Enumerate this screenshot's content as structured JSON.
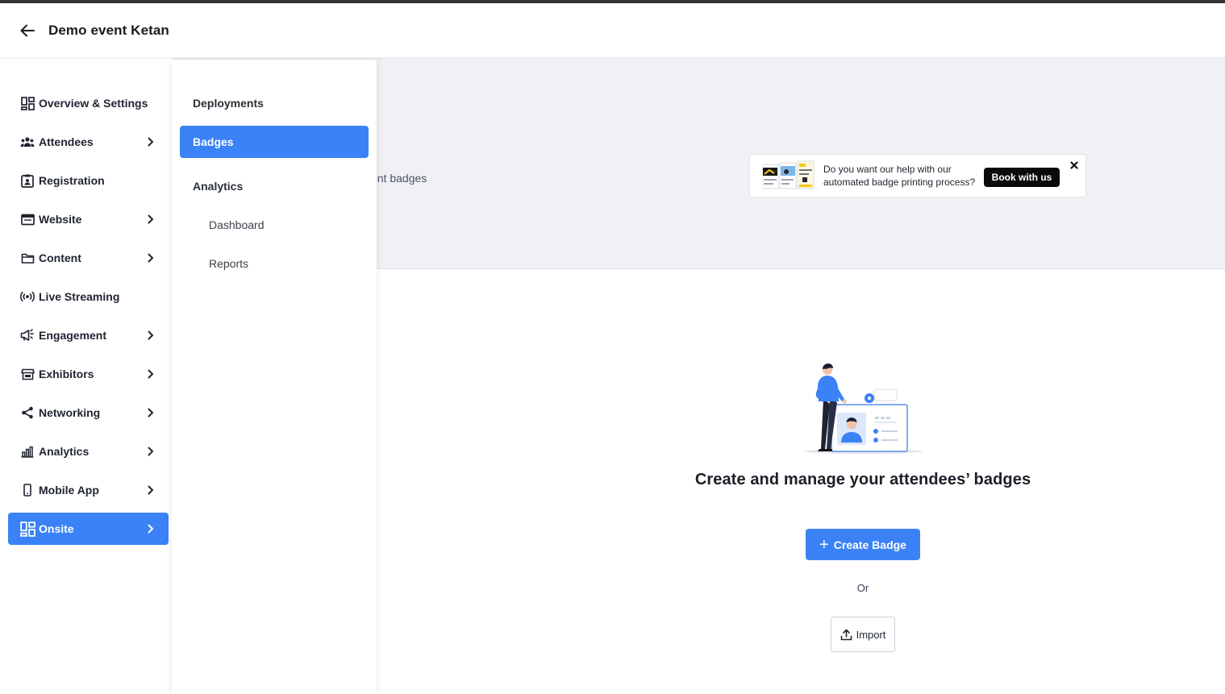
{
  "header": {
    "title": "Demo event Ketan"
  },
  "sidebar": {
    "items": [
      {
        "label": "Overview & Settings",
        "icon": "dashboard-grid-icon",
        "has_children": false
      },
      {
        "label": "Attendees",
        "icon": "people-icon",
        "has_children": true
      },
      {
        "label": "Registration",
        "icon": "id-card-icon",
        "has_children": false
      },
      {
        "label": "Website",
        "icon": "browser-window-icon",
        "has_children": true
      },
      {
        "label": "Content",
        "icon": "folder-icon",
        "has_children": true
      },
      {
        "label": "Live Streaming",
        "icon": "broadcast-icon",
        "has_children": false
      },
      {
        "label": "Engagement",
        "icon": "megaphone-icon",
        "has_children": true
      },
      {
        "label": "Exhibitors",
        "icon": "storefront-icon",
        "has_children": true
      },
      {
        "label": "Networking",
        "icon": "share-nodes-icon",
        "has_children": true
      },
      {
        "label": "Analytics",
        "icon": "bar-chart-icon",
        "has_children": true
      },
      {
        "label": "Mobile App",
        "icon": "mobile-phone-icon",
        "has_children": true
      },
      {
        "label": "Onsite",
        "icon": "dashboard-grid-icon",
        "has_children": true,
        "active": true
      }
    ]
  },
  "submenu": {
    "items": [
      {
        "label": "Deployments",
        "level": 1
      },
      {
        "label": "Badges",
        "level": 1,
        "active": true
      },
      {
        "label": "Analytics",
        "level": 1
      },
      {
        "label": "Dashboard",
        "level": 2
      },
      {
        "label": "Reports",
        "level": 2
      }
    ]
  },
  "background": {
    "partial_text": "ent badges"
  },
  "promo": {
    "text": "Do you want our help with our automated badge printing process?",
    "button_label": "Book with us"
  },
  "empty_state": {
    "title": "Create and manage your attendees’ badges",
    "create_label": "Create Badge",
    "or_label": "Or",
    "import_label": "Import"
  },
  "colors": {
    "accent": "#3b82f6",
    "dark_button": "#0a0a0a",
    "band": "#f0f1f5"
  }
}
